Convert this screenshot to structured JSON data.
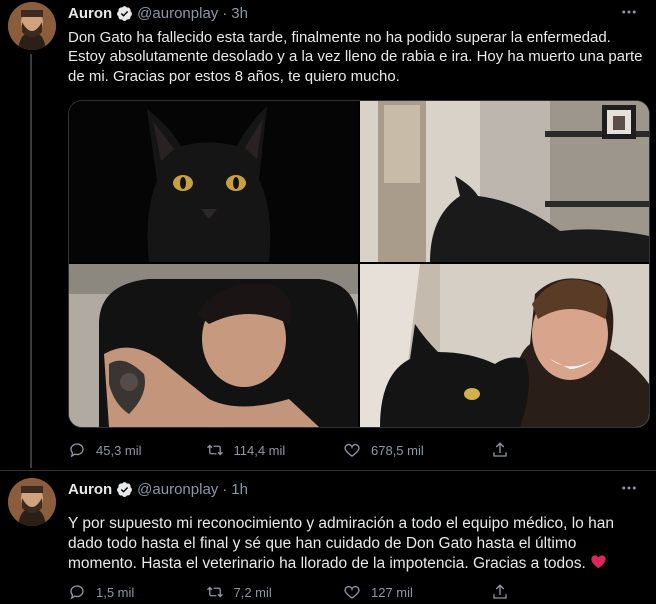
{
  "tweets": [
    {
      "name": "Auron",
      "handle": "@auronplay",
      "separator": "·",
      "time": "3h",
      "text": "Don Gato ha fallecido esta tarde, finalmente no ha podido superar la enfermedad. Estoy absolutamente desolado y a la vez lleno de rabia e ira. Hoy ha muerto una parte de mi. Gracias por estos 8 años, te quiero mucho.",
      "reply_count": "45,3 mil",
      "retweet_count": "114,4 mil",
      "like_count": "678,5 mil"
    },
    {
      "name": "Auron",
      "handle": "@auronplay",
      "separator": "·",
      "time": "1h",
      "text": "Y por supuesto mi reconocimiento y admiración a todo el equipo médico, lo han dado todo hasta el final y sé que han cuidado de Don Gato hasta el último momento. Hasta el veterinario ha llorado de la impotencia. Gracias a todos.",
      "emoji": "heart-emoji",
      "reply_count": "1,5 mil",
      "retweet_count": "7,2 mil",
      "like_count": "127 mil"
    }
  ],
  "icons": {
    "verified": "verified-badge-icon",
    "more": "more-icon",
    "reply": "reply-icon",
    "retweet": "retweet-icon",
    "like": "like-icon",
    "share": "share-icon"
  },
  "colors": {
    "background": "#000000",
    "text": "#e7e9ea",
    "muted": "#8b98a5",
    "verified": "#e7e9ea",
    "heart": "#e0245e"
  }
}
